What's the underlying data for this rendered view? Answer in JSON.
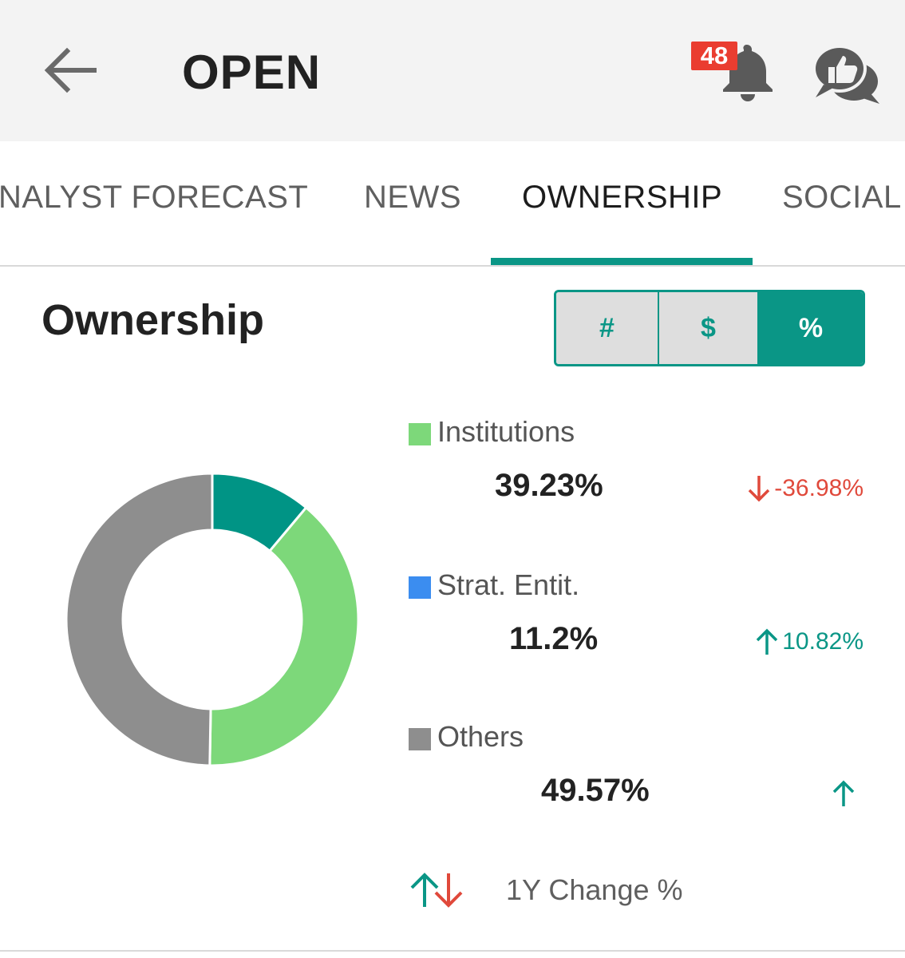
{
  "header": {
    "title": "OPEN",
    "notification_count": "48"
  },
  "tabs": [
    {
      "label": "NALYST FORECAST"
    },
    {
      "label": "NEWS"
    },
    {
      "label": "OWNERSHIP",
      "active": true
    },
    {
      "label": "SOCIAL"
    }
  ],
  "section": {
    "title": "Ownership",
    "toggle": [
      "#",
      "$",
      "%"
    ],
    "toggle_selected": "%"
  },
  "colors": {
    "accent": "#0a9686",
    "up": "#0a9686",
    "down": "#e0493b",
    "institutions": "#7dd87a",
    "strat_entities": "#3b8df0",
    "others": "#8e8e8e",
    "donut_extra": "#009485"
  },
  "legend": [
    {
      "label": "Institutions",
      "value": "39.23%",
      "change": "-36.98%",
      "direction": "down"
    },
    {
      "label": "Strat. Entit.",
      "value": "11.2%",
      "change": "10.82%",
      "direction": "up"
    },
    {
      "label": "Others",
      "value": "49.57%",
      "change": "",
      "direction": "up"
    }
  ],
  "footer": {
    "label": "1Y Change %"
  }
}
